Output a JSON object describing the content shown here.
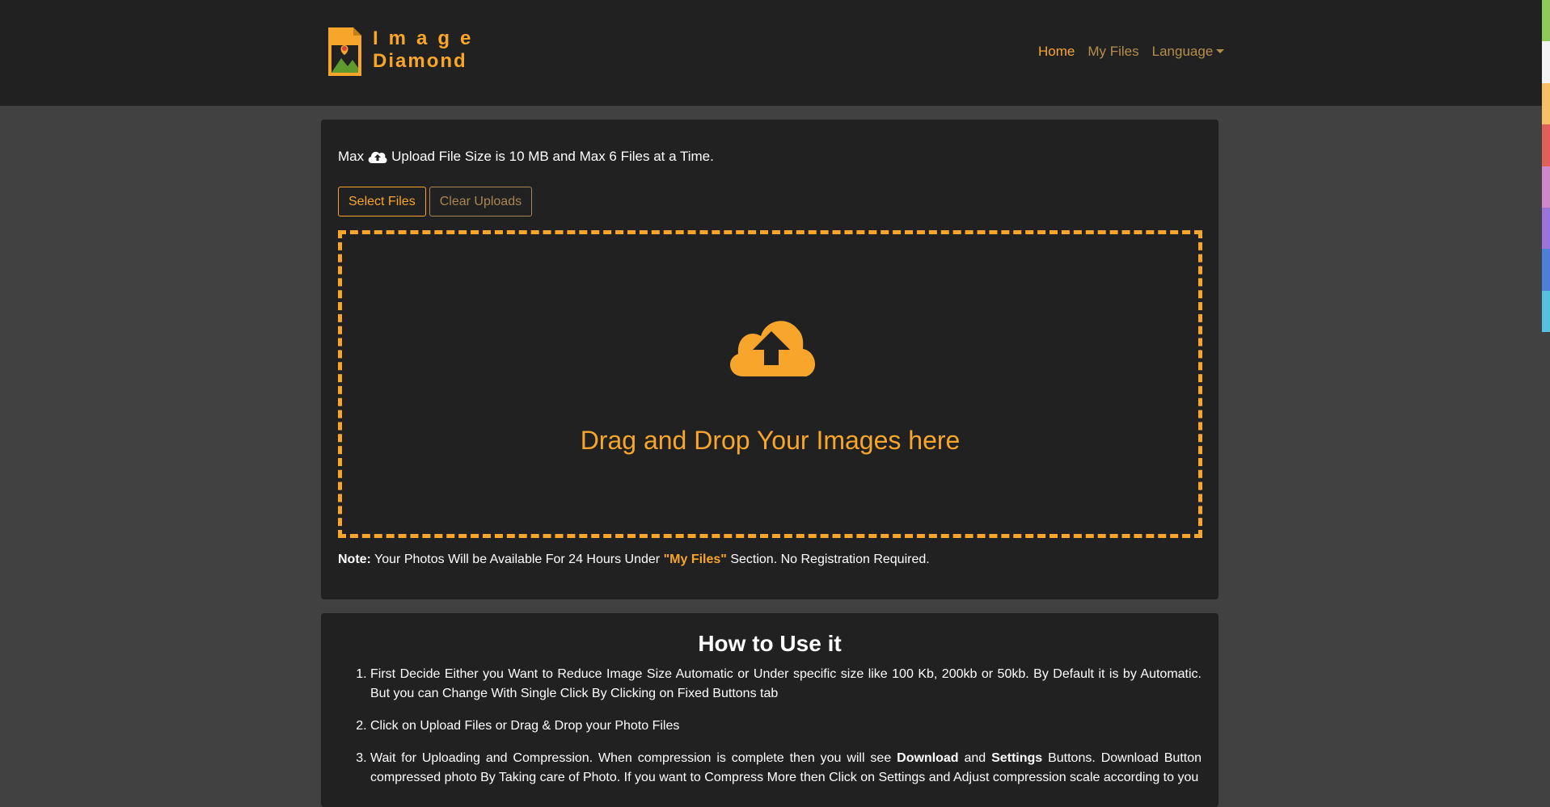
{
  "brand": {
    "line1": "Image",
    "line2": "Diamond"
  },
  "nav": {
    "home": "Home",
    "my_files": "My Files",
    "language": "Language"
  },
  "colors": {
    "accent": "#f7a52b",
    "dim_accent": "#b58e4c",
    "card": "#212121",
    "page": "#414141"
  },
  "upload": {
    "info_prefix": "Max",
    "info_suffix": "Upload File Size is 10 MB and Max 6 Files at a Time.",
    "select_label": "Select Files",
    "clear_label": "Clear Uploads",
    "dropzone_text": "Drag and Drop Your Images here",
    "note_label": "Note:",
    "note_before": " Your Photos Will be Available For 24 Hours Under ",
    "note_highlight": "\"My Files\"",
    "note_after": " Section. No Registration Required."
  },
  "howto": {
    "title": "How to Use it",
    "step1": "First Decide Either you Want to Reduce Image Size Automatic or Under specific size like 100 Kb, 200kb or 50kb. By Default it is by Automatic. But you can Change With Single Click By Clicking on Fixed Buttons tab",
    "step2": "Click on Upload Files or Drag & Drop your Photo Files",
    "step3_a": "Wait for Uploading and Compression. When compression is complete then you will see ",
    "step3_download": "Download",
    "step3_and": " and ",
    "step3_settings": "Settings",
    "step3_b": " Buttons. Download Button compressed photo By Taking care of Photo. If you want to Compress More then Click on Settings and Adjust compression scale according to you"
  },
  "icons": {
    "logo": "image-file-logo-icon",
    "info_cloud": "cloud-upload-icon",
    "dropzone_cloud": "cloud-upload-icon",
    "caret": "caret-down-icon"
  }
}
